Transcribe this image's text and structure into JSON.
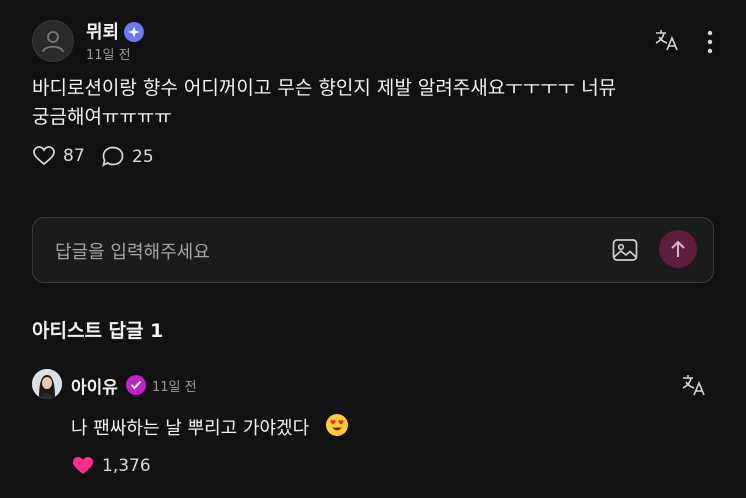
{
  "post": {
    "author": "뮈뢰",
    "time": "11일 전",
    "text": "바디로션이랑 향수 어디꺼이고 무슨 향인지 제발 알려주새요ㅜㅜㅜㅜ 너뮤 궁금해여ㅠㅠㅠㅠ",
    "likes": "87",
    "comments": "25"
  },
  "reply": {
    "placeholder": "답글을 입력해주세요"
  },
  "artist_section": {
    "title": "아티스트 답글 1",
    "comment": {
      "author": "아이유",
      "time": "11일 전",
      "text": "나 팬싸하는 날 뿌리고 가야겠다",
      "likes": "1,376"
    }
  },
  "colors": {
    "background": "#111111",
    "verified": "#6d79f2",
    "artist_badge": "#c21fd0",
    "heart": "#ff2e8c",
    "send_button": "#5e1d3c"
  },
  "icons": [
    "user-icon",
    "star-badge-icon",
    "translate-icon",
    "more-vertical-icon",
    "heart-outline-icon",
    "comment-icon",
    "image-icon",
    "arrow-up-icon",
    "check-badge-icon",
    "heart-filled-icon",
    "heart-eyes-emoji"
  ]
}
